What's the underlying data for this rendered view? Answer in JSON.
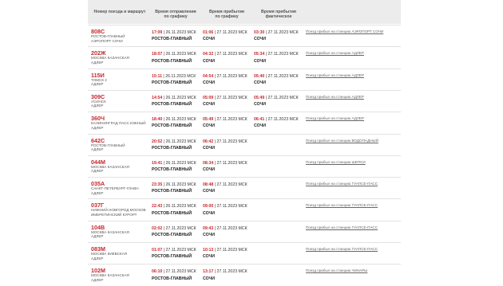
{
  "headers": {
    "train": "Номер поезда и маршрут",
    "dep": [
      "Время отправления",
      "по графику"
    ],
    "arr": [
      "Время прибытия",
      "по графику"
    ],
    "fact": [
      "Время прибытия",
      "фактическое"
    ]
  },
  "rows": [
    {
      "num": "808С",
      "route": [
        "РОСТОВ-ГЛАВНЫЙ",
        "АЭРОПОРТ СОЧИ"
      ],
      "dep_time": "17:09",
      "dep_date": " | 26.11.2023 МСК",
      "dep_station": "РОСТОВ-ГЛАВНЫЙ",
      "arr_time": "01:06",
      "arr_date": " | 27.11.2023 МСК",
      "arr_station": "СОЧИ",
      "fact_time": "03:30",
      "fact_date": " | 27.11.2023 МСК",
      "fact_station": "СОЧИ",
      "link": "Поезд прибыл на станцию АЭРОПОРТ СОЧИ"
    },
    {
      "num": "202Ж",
      "route": [
        "МОСКВА КАЗАНСКАЯ",
        "АДЛЕР"
      ],
      "dep_time": "18:07",
      "dep_date": " | 26.11.2023 МСК",
      "dep_station": "РОСТОВ-ГЛАВНЫЙ",
      "arr_time": "04:32",
      "arr_date": " | 27.11.2023 МСК",
      "arr_station": "СОЧИ",
      "fact_time": "05:34",
      "fact_date": " | 27.11.2023 МСК",
      "fact_station": "СОЧИ",
      "link": "Поезд прибыл на станцию АДЛЕР"
    },
    {
      "num": "115И",
      "route": [
        "ТОМСК 2",
        "АДЛЕР"
      ],
      "dep_time": "15:11",
      "dep_date": " | 26.11.2023 МСК",
      "dep_station": "РОСТОВ-ГЛАВНЫЙ",
      "arr_time": "04:54",
      "arr_date": " | 27.11.2023 МСК",
      "arr_station": "СОЧИ",
      "fact_time": "05:40",
      "fact_date": " | 27.11.2023 МСК",
      "fact_station": "СОЧИ",
      "link": "Поезд прибыл на станцию АДЛЕР"
    },
    {
      "num": "309С",
      "route": [
        "УСИНСК",
        "АДЛЕР"
      ],
      "dep_time": "14:54",
      "dep_date": " | 26.11.2023 МСК",
      "dep_station": "РОСТОВ-ГЛАВНЫЙ",
      "arr_time": "05:09",
      "arr_date": " | 27.11.2023 МСК",
      "arr_station": "СОЧИ",
      "fact_time": "05:49",
      "fact_date": " | 27.11.2023 МСК",
      "fact_station": "СОЧИ",
      "link": "Поезд прибыл на станцию АДЛЕР"
    },
    {
      "num": "360Ч",
      "route": [
        "КАЛИНИНГРАД ПАСС.ЮЖНЫЙ",
        "АДЛЕР"
      ],
      "dep_time": "18:40",
      "dep_date": " | 26.11.2023 МСК",
      "dep_station": "РОСТОВ-ГЛАВНЫЙ",
      "arr_time": "05:49",
      "arr_date": " | 27.11.2023 МСК",
      "arr_station": "СОЧИ",
      "fact_time": "06:41",
      "fact_date": " | 27.11.2023 МСК",
      "fact_station": "СОЧИ",
      "link": "Поезд прибыл на станцию АДЛЕР"
    },
    {
      "num": "642С",
      "route": [
        "РОСТОВ-ГЛАВНЫЙ",
        "АДЛЕР"
      ],
      "dep_time": "20:52",
      "dep_date": " | 26.11.2023 МСК",
      "dep_station": "РОСТОВ-ГЛАВНЫЙ",
      "arr_time": "06:42",
      "arr_date": " | 27.11.2023 МСК",
      "arr_station": "СОЧИ",
      "fact_time": "",
      "fact_date": "",
      "fact_station": "",
      "link": "Поезд прибыл на станцию ВОДОПАДНЫЙ"
    },
    {
      "num": "044М",
      "route": [
        "МОСКВА КАЗАНСКАЯ",
        "АДЛЕР"
      ],
      "dep_time": "19:41",
      "dep_date": " | 26.11.2023 МСК",
      "dep_station": "РОСТОВ-ГЛАВНЫЙ",
      "arr_time": "08:34",
      "arr_date": " | 27.11.2023 МСК",
      "arr_station": "СОЧИ",
      "fact_time": "",
      "fact_date": "",
      "fact_station": "",
      "link": "Поезд прибыл на станцию ШЕПСИ"
    },
    {
      "num": "035А",
      "route": [
        "САНКТ-ПЕТЕРБУРГ-ГЛАВН",
        "АДЛЕР"
      ],
      "dep_time": "23:35",
      "dep_date": " | 26.11.2023 МСК",
      "dep_station": "РОСТОВ-ГЛАВНЫЙ",
      "arr_time": "08:48",
      "arr_date": " | 27.11.2023 МСК",
      "arr_station": "СОЧИ",
      "fact_time": "",
      "fact_date": "",
      "fact_station": "",
      "link": "Поезд прибыл на станцию ТУАПСЕ-ПАСС"
    },
    {
      "num": "037Г",
      "route": [
        "НИЖНИЙ НОВГОРОД МОСКОВ",
        "ИМЕРЕТИНСКИЙ КУРОРТ"
      ],
      "dep_time": "22:43",
      "dep_date": " | 26.11.2023 МСК",
      "dep_station": "РОСТОВ-ГЛАВНЫЙ",
      "arr_time": "09:00",
      "arr_date": " | 27.11.2023 МСК",
      "arr_station": "СОЧИ",
      "fact_time": "",
      "fact_date": "",
      "fact_station": "",
      "link": "Поезд прибыл на станцию ТУАПСЕ-ПАСС"
    },
    {
      "num": "104В",
      "route": [
        "МОСКВА КАЗАНСКАЯ",
        "АДЛЕР"
      ],
      "dep_time": "02:02",
      "dep_date": " | 27.11.2023 МСК",
      "dep_station": "РОСТОВ-ГЛАВНЫЙ",
      "arr_time": "09:43",
      "arr_date": " | 27.11.2023 МСК",
      "arr_station": "СОЧИ",
      "fact_time": "",
      "fact_date": "",
      "fact_station": "",
      "link": "Поезд прибыл на станцию ТУАПСЕ-ПАСС"
    },
    {
      "num": "083М",
      "route": [
        "МОСКВА КИЕВСКАЯ",
        "АДЛЕР"
      ],
      "dep_time": "01:07",
      "dep_date": " | 27.11.2023 МСК",
      "dep_station": "РОСТОВ-ГЛАВНЫЙ",
      "arr_time": "10:13",
      "arr_date": " | 27.11.2023 МСК",
      "arr_station": "СОЧИ",
      "fact_time": "",
      "fact_date": "",
      "fact_station": "",
      "link": "Поезд прибыл на станцию ТУАПСЕ-ПАСС"
    },
    {
      "num": "102М",
      "route": [
        "МОСКВА КАЗАНСКАЯ",
        "АДЛЕР"
      ],
      "dep_time": "06:10",
      "dep_date": " | 27.11.2023 МСК",
      "dep_station": "РОСТОВ-ГЛАВНЫЙ",
      "arr_time": "13:17",
      "arr_date": " | 27.11.2023 МСК",
      "arr_station": "СОЧИ",
      "fact_time": "",
      "fact_date": "",
      "fact_station": "",
      "link": "Поезд прибыл на станцию ЧИНАРЫ"
    }
  ]
}
